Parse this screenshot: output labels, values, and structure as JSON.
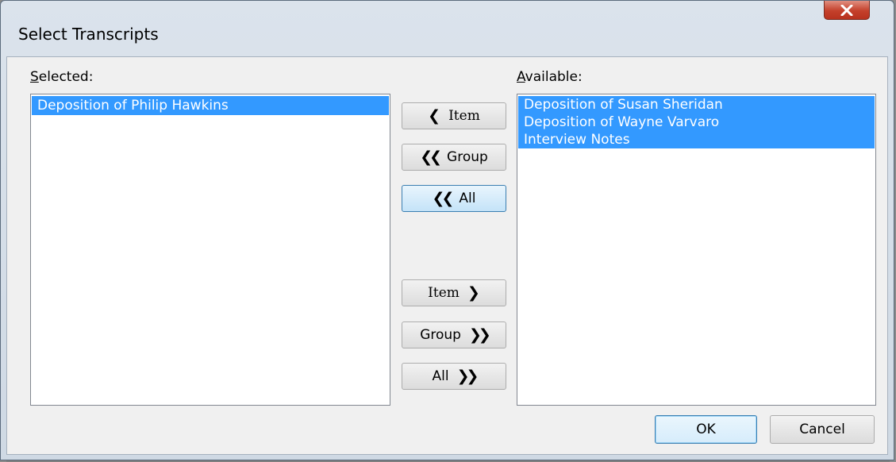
{
  "window": {
    "title": "Select Transcripts",
    "close_glyph": "✕"
  },
  "selected": {
    "label_mnemonic": "S",
    "label_rest": "elected:",
    "items": [
      "Deposition of Philip Hawkins"
    ]
  },
  "available": {
    "label_mnemonic": "A",
    "label_rest": "vailable:",
    "items": [
      "Deposition of Susan Sheridan",
      "Deposition of Wayne Varvaro",
      "Interview Notes"
    ]
  },
  "move_buttons": {
    "item_left": {
      "glyph": "❮",
      "label": "Item"
    },
    "group_left": {
      "glyph": "❮❮",
      "label": "Group"
    },
    "all_left": {
      "glyph": "❮❮",
      "label": "All"
    },
    "item_right": {
      "glyph": "❯",
      "label": "Item"
    },
    "group_right": {
      "glyph": "❯❯",
      "label": "Group"
    },
    "all_right": {
      "glyph": "❯❯",
      "label": "All"
    }
  },
  "footer": {
    "ok_label": "OK",
    "cancel_label": "Cancel"
  },
  "colors": {
    "selection": "#3399ff",
    "close_button": "#c4402b",
    "hot_button_border": "#3c7fb1"
  },
  "icons": {
    "close": "close-icon",
    "left": "chevron-left-icon",
    "double_left": "double-chevron-left-icon",
    "right": "chevron-right-icon",
    "double_right": "double-chevron-right-icon"
  }
}
